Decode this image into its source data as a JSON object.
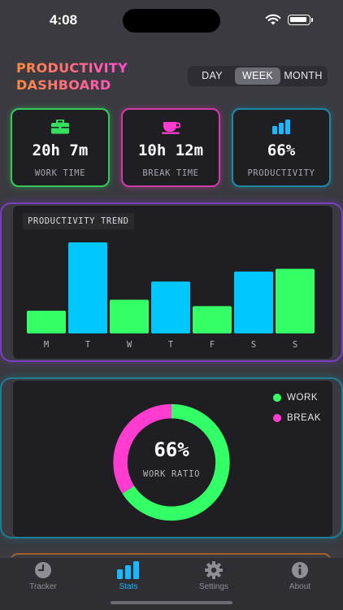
{
  "status_bar": {
    "time": "4:08"
  },
  "header": {
    "title_line1": "PRODUCTIVITY",
    "title_line2": "DASHBOARD",
    "segments": [
      "DAY",
      "WEEK",
      "MONTH"
    ],
    "selected_segment": "WEEK"
  },
  "stats": {
    "work": {
      "value": "20h 7m",
      "label": "WORK TIME",
      "icon": "briefcase-icon",
      "color": "#36c95a"
    },
    "break": {
      "value": "10h 12m",
      "label": "BREAK TIME",
      "icon": "coffee-cup-icon",
      "color": "#ff3ccf"
    },
    "productivity": {
      "value": "66%",
      "label": "PRODUCTIVITY",
      "icon": "bar-chart-icon",
      "color": "#19b8ff"
    }
  },
  "trend": {
    "title": "PRODUCTIVITY TREND"
  },
  "ratio": {
    "value": "66%",
    "label": "WORK RATIO",
    "legend": [
      {
        "label": "WORK",
        "color": "#33ff66"
      },
      {
        "label": "BREAK",
        "color": "#ff3ccf"
      }
    ]
  },
  "chart_data": [
    {
      "type": "bar",
      "title": "PRODUCTIVITY TREND",
      "categories": [
        "M",
        "T",
        "W",
        "T",
        "F",
        "S",
        "S"
      ],
      "values": [
        2.5,
        10,
        3.7,
        5.7,
        3,
        6.8,
        7.1
      ],
      "bar_colors": [
        "#33ff66",
        "#00c8ff",
        "#33ff66",
        "#00c8ff",
        "#33ff66",
        "#00c8ff",
        "#33ff66"
      ],
      "ylim": [
        0,
        10
      ],
      "grid": false
    },
    {
      "type": "pie",
      "categories": [
        "WORK",
        "BREAK"
      ],
      "values": [
        66,
        34
      ],
      "colors": [
        "#33ff66",
        "#ff3ccf"
      ]
    }
  ],
  "tabbar": {
    "tabs": [
      {
        "label": "Tracker",
        "icon": "clock-icon"
      },
      {
        "label": "Stats",
        "icon": "bar-chart-icon"
      },
      {
        "label": "Settings",
        "icon": "gear-icon"
      },
      {
        "label": "About",
        "icon": "info-icon"
      }
    ],
    "active": "Stats"
  }
}
